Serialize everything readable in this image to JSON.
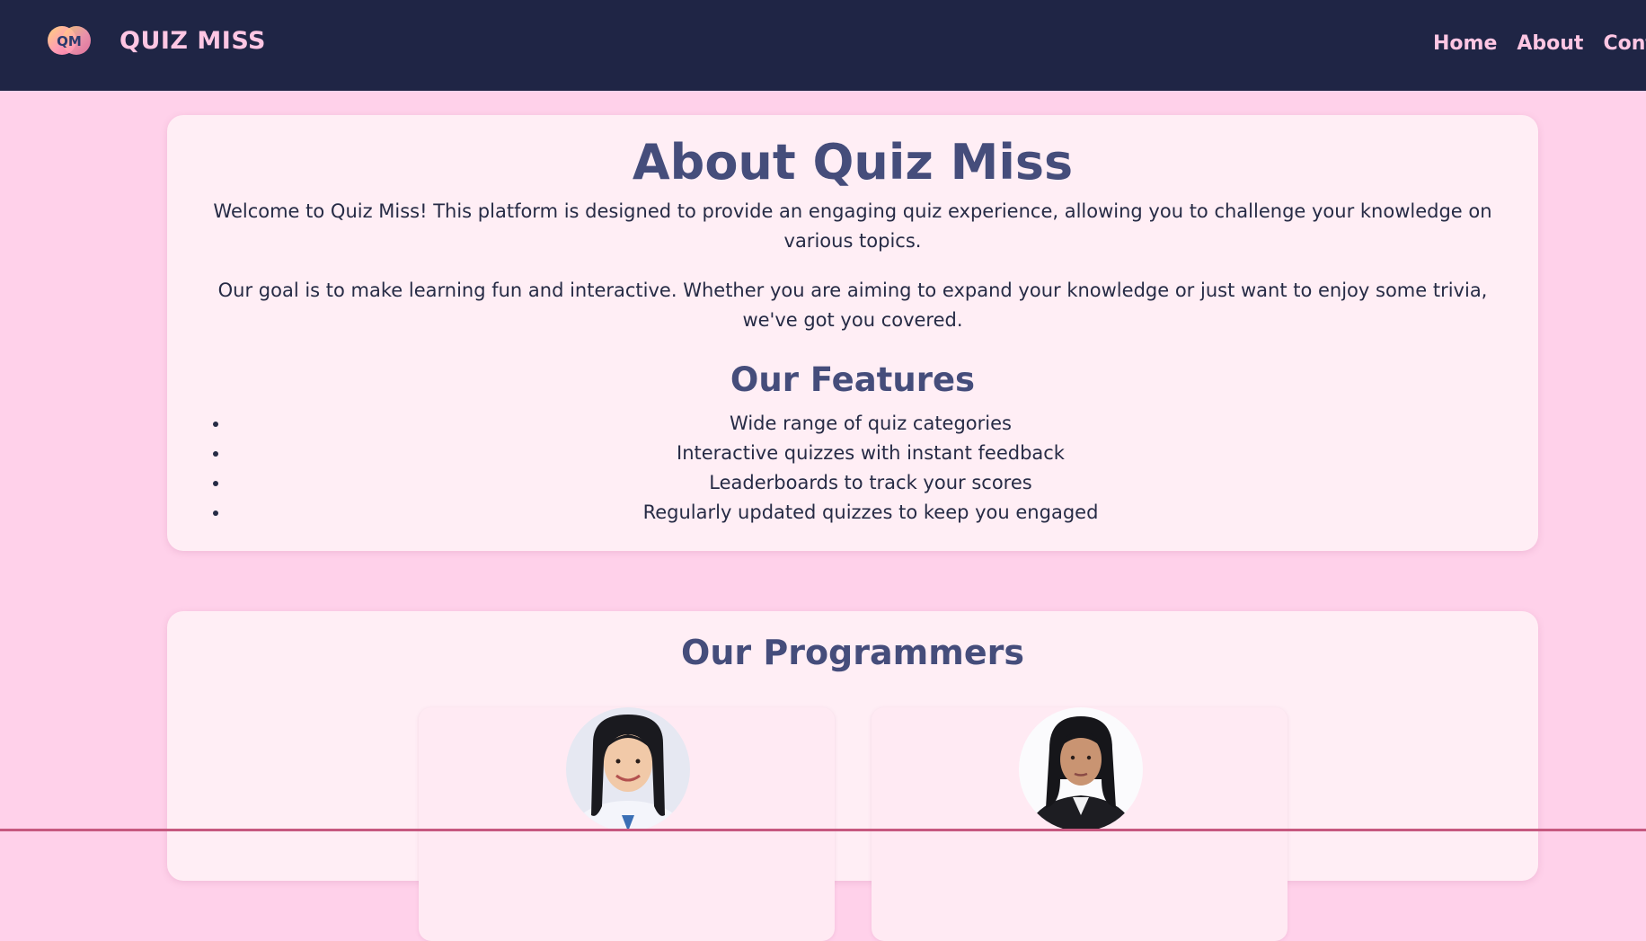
{
  "nav": {
    "logo_text": "QM",
    "brand": "QUIZ MISS",
    "links": [
      {
        "label": "Home"
      },
      {
        "label": "About"
      },
      {
        "label": "Contac"
      }
    ]
  },
  "about": {
    "title": "About Quiz Miss",
    "paragraphs": [
      "Welcome to Quiz Miss! This platform is designed to provide an engaging quiz experience, allowing you to challenge your knowledge on various topics.",
      "Our goal is to make learning fun and interactive. Whether you are aiming to expand your knowledge or just want to enjoy some trivia, we've got you covered."
    ],
    "features_title": "Our Features",
    "features": [
      "Wide range of quiz categories",
      "Interactive quizzes with instant feedback",
      "Leaderboards to track your scores",
      "Regularly updated quizzes to keep you engaged"
    ]
  },
  "programmers": {
    "title": "Our Programmers"
  },
  "colors": {
    "navbar_bg": "#1f2545",
    "nav_text": "#ffc6e3",
    "page_bg": "#ffd1ea",
    "card_bg": "#ffeef5",
    "heading": "#454d7b"
  }
}
